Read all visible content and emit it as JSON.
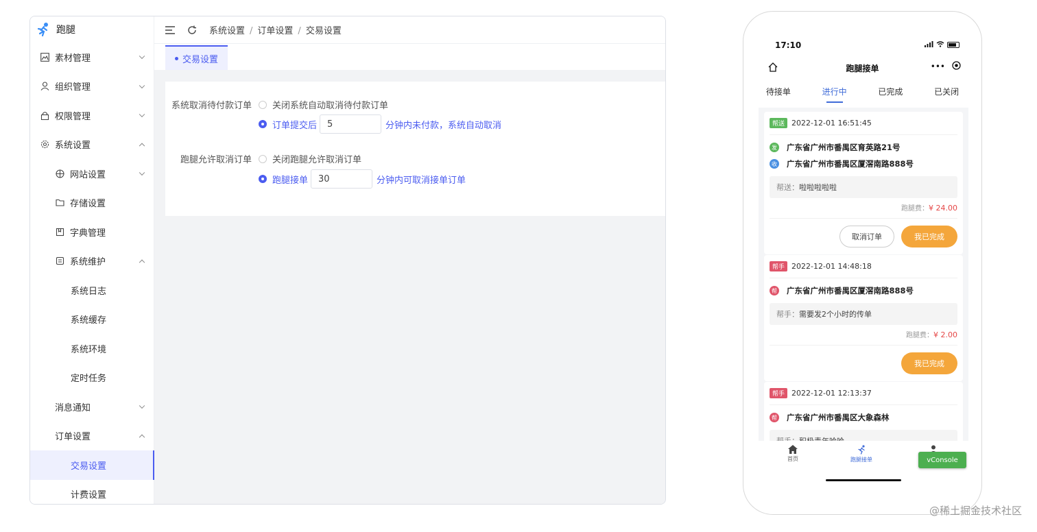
{
  "admin": {
    "brand": "跑腿",
    "sidebar": [
      {
        "label": "素材管理"
      },
      {
        "label": "组织管理"
      },
      {
        "label": "权限管理"
      },
      {
        "label": "系统设置"
      },
      {
        "label": "网站设置"
      },
      {
        "label": "存储设置"
      },
      {
        "label": "字典管理"
      },
      {
        "label": "系统维护"
      },
      {
        "label": "系统日志"
      },
      {
        "label": "系统缓存"
      },
      {
        "label": "系统环境"
      },
      {
        "label": "定时任务"
      },
      {
        "label": "消息通知"
      },
      {
        "label": "订单设置"
      },
      {
        "label": "交易设置"
      },
      {
        "label": "计费设置"
      }
    ],
    "breadcrumb": [
      "系统设置",
      "订单设置",
      "交易设置"
    ],
    "breadcrumb_sep": "/",
    "tab": "交易设置",
    "form": {
      "row1_label": "系统取消待付款订单",
      "row1_opt1": "关闭系统自动取消待付款订单",
      "row1_opt2": "订单提交后",
      "row1_value": "5",
      "row1_suffix": "分钟内未付款，系统自动取消",
      "row2_label": "跑腿允许取消订单",
      "row2_opt1": "关闭跑腿允许取消订单",
      "row2_opt2": "跑腿接单",
      "row2_value": "30",
      "row2_suffix": "分钟内可取消接单订单"
    }
  },
  "phone": {
    "time": "17:10",
    "title": "跑腿接单",
    "capsule": "•••",
    "tabs": [
      "待接单",
      "进行中",
      "已完成",
      "已关闭"
    ],
    "orders": [
      {
        "badge": "帮送",
        "badge_color": "#5cb85c",
        "time": "2022-12-01 16:51:45",
        "addr1_badge": "发",
        "addr1": "广东省广州市番禺区育英路21号",
        "addr2_badge": "收",
        "addr2": "广东省广州市番禺区厦滘南路888号",
        "note_key": "帮送：",
        "note": "啦啦啦啦啦",
        "fee_key": "跑腿费：",
        "fee": "¥ 24.00",
        "cancel": "取消订单",
        "done": "我已完成"
      },
      {
        "badge": "帮手",
        "badge_color": "#e0556a",
        "time": "2022-12-01 14:48:18",
        "addr1_badge": "帮",
        "addr1": "广东省广州市番禺区厦滘南路888号",
        "note_key": "帮手：",
        "note": "需要发2个小时的传单",
        "fee_key": "跑腿费：",
        "fee": "¥ 2.00",
        "done": "我已完成"
      },
      {
        "badge": "帮手",
        "badge_color": "#e0556a",
        "time": "2022-12-01 12:13:37",
        "addr1_badge": "帮",
        "addr1": "广东省广州市番禺区大象森林",
        "note_key": "帮手：",
        "note": "积极青年哈哈"
      }
    ],
    "bottom_nav": [
      "首页",
      "跑腿接单"
    ],
    "vconsole": "vConsole"
  },
  "watermark": "@稀土掘金技术社区",
  "colors": {
    "accent": "#4b5cf0",
    "phone_accent": "#3f6bd8",
    "orange": "#f4a63b",
    "price": "#e54646"
  }
}
